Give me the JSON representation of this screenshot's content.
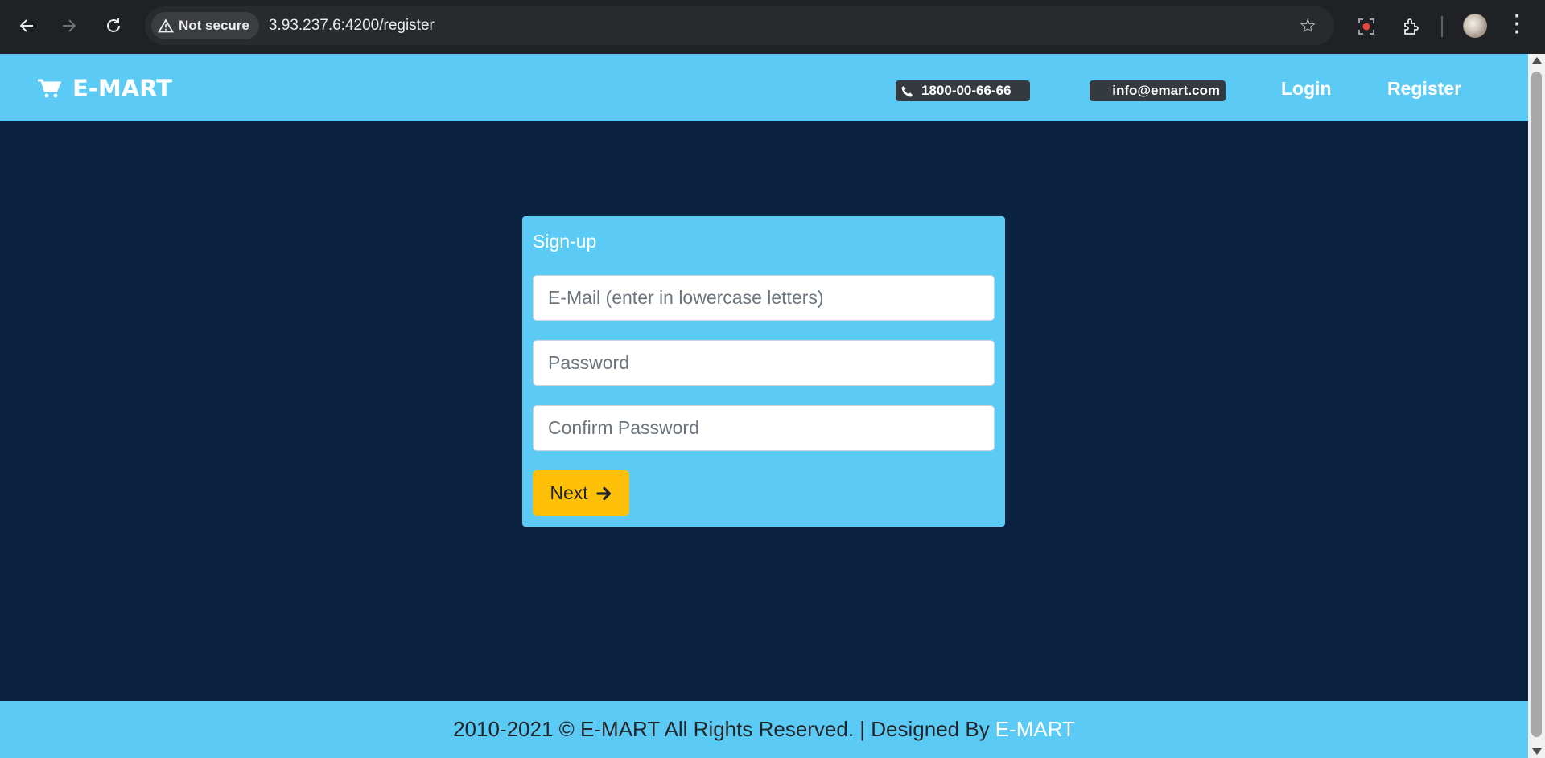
{
  "browser": {
    "security_label": "Not secure",
    "url": "3.93.237.6:4200/register",
    "icons": [
      "back-arrow-icon",
      "forward-arrow-icon",
      "reload-icon",
      "warning-triangle-icon",
      "bookmark-star-icon",
      "screen-record-icon",
      "extensions-puzzle-icon",
      "profile-avatar",
      "kebab-menu-icon"
    ]
  },
  "header": {
    "brand": "E-MART",
    "brand_icon": "shopping-cart-icon",
    "phone": "1800-00-66-66",
    "phone_icon": "phone-icon",
    "email": "info@emart.com",
    "nav": {
      "login": "Login",
      "register": "Register"
    }
  },
  "signup": {
    "title": "Sign-up",
    "email_placeholder": "E-Mail (enter in lowercase letters)",
    "password_placeholder": "Password",
    "confirm_placeholder": "Confirm Password",
    "next_label": "Next",
    "next_icon": "arrow-right-icon"
  },
  "footer": {
    "text": "2010-2021 © E-MART All Rights Reserved. | Designed By",
    "brand_link": "E-MART"
  },
  "colors": {
    "header_bg": "#5bcbf5",
    "page_bg": "#0b2340",
    "button_bg": "#ffc107",
    "pill_bg": "#343a40"
  }
}
